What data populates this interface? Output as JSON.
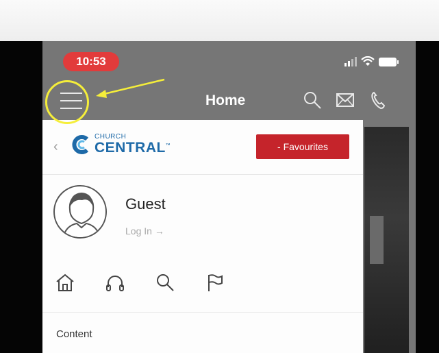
{
  "status_bar": {
    "time": "10:53"
  },
  "nav": {
    "title": "Home",
    "icons": [
      "menu-icon",
      "search-icon",
      "mail-icon",
      "phone-icon"
    ]
  },
  "drawer": {
    "logo": {
      "line1": "CHURCH",
      "line2": "CENTRAL",
      "tm": "™"
    },
    "favourites_button": "- Favourites",
    "profile": {
      "name": "Guest",
      "login_link": "Log In →"
    },
    "quick_icons": [
      "home-icon",
      "headphones-icon",
      "search-icon",
      "flag-icon"
    ],
    "section_label": "Content"
  },
  "colors": {
    "accent_red": "#c5242b",
    "brand_blue": "#1e6aa8",
    "highlight_yellow": "#f5ee3a",
    "time_pill": "#e23b3b"
  }
}
